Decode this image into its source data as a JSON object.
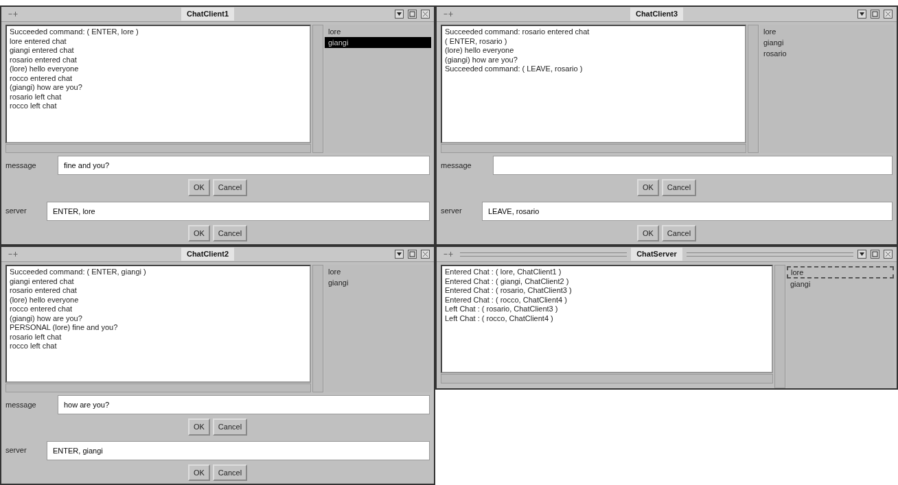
{
  "windows": [
    {
      "kind": "client",
      "title": "ChatClient1",
      "log": [
        "Succeeded command: ( ENTER, lore )",
        "lore entered chat",
        "giangi entered chat",
        "rosario entered chat",
        "(lore) hello everyone",
        "rocco entered chat",
        "(giangi) how are you?",
        "rosario left chat",
        "rocco left chat"
      ],
      "users": [
        {
          "name": "lore",
          "selected": false,
          "focused": false
        },
        {
          "name": "giangi",
          "selected": true,
          "focused": false
        }
      ],
      "message": {
        "label": "message",
        "value": "fine and you?",
        "buttons": [
          "OK",
          "Cancel"
        ]
      },
      "server": {
        "label": "server",
        "value": "ENTER, lore",
        "buttons": [
          "OK",
          "Cancel"
        ]
      }
    },
    {
      "kind": "client",
      "title": "ChatClient3",
      "log": [
        "Succeeded command: rosario entered chat",
        "( ENTER, rosario )",
        "(lore) hello everyone",
        "(giangi) how are you?",
        "Succeeded command: ( LEAVE, rosario )"
      ],
      "users": [
        {
          "name": "lore",
          "selected": false,
          "focused": false
        },
        {
          "name": "giangi",
          "selected": false,
          "focused": false
        },
        {
          "name": "rosario",
          "selected": false,
          "focused": false
        }
      ],
      "message": {
        "label": "message",
        "buttons": [
          "OK",
          "Cancel"
        ]
      },
      "server": {
        "label": "server",
        "value": "LEAVE, rosario",
        "buttons": [
          "OK",
          "Cancel"
        ]
      }
    },
    {
      "kind": "client",
      "title": "ChatClient2",
      "log": [
        "Succeeded command: ( ENTER, giangi )",
        "giangi entered chat",
        "rosario entered chat",
        "(lore) hello everyone",
        "rocco entered chat",
        "(giangi) how are you?",
        "PERSONAL (lore) fine and you?",
        "rosario left chat",
        "rocco left chat"
      ],
      "users": [
        {
          "name": "lore",
          "selected": false,
          "focused": false
        },
        {
          "name": "giangi",
          "selected": false,
          "focused": false
        }
      ],
      "message": {
        "label": "message",
        "value": "how are you?",
        "buttons": [
          "OK",
          "Cancel"
        ]
      },
      "server": {
        "label": "server",
        "value": "ENTER, giangi",
        "buttons": [
          "OK",
          "Cancel"
        ]
      }
    },
    {
      "kind": "server",
      "title": "ChatServer",
      "log": [
        "Entered Chat : ( lore, ChatClient1 )",
        "Entered Chat : ( giangi, ChatClient2 )",
        "Entered Chat : ( rosario, ChatClient3 )",
        "Entered Chat : ( rocco, ChatClient4 )",
        "Left Chat : ( rosario, ChatClient3 )",
        "Left Chat : ( rocco, ChatClient4 )"
      ],
      "users": [
        {
          "name": "lore",
          "selected": false,
          "focused": true
        },
        {
          "name": "giangi",
          "selected": false,
          "focused": false
        }
      ]
    }
  ]
}
